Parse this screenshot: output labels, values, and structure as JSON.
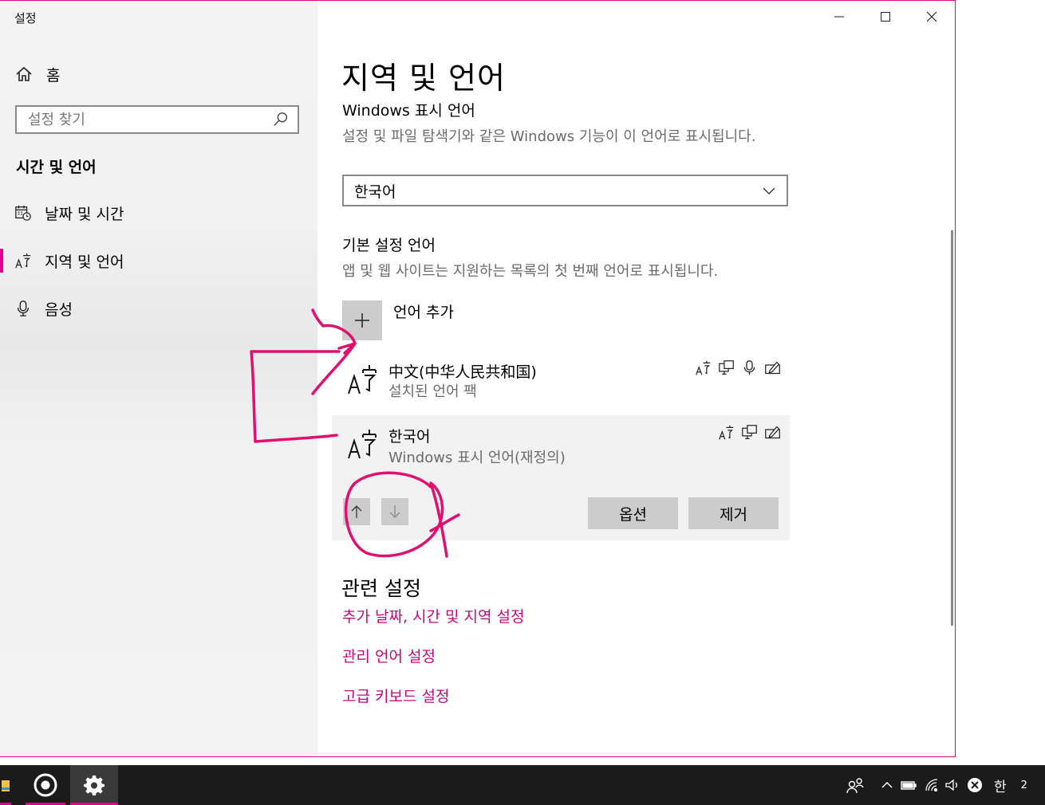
{
  "window": {
    "app_title": "설정",
    "controls": {
      "minimize": "minimize-icon",
      "maximize": "maximize-icon",
      "close": "close-icon"
    }
  },
  "sidebar": {
    "home_label": "홈",
    "search_placeholder": "설정 찾기",
    "section_title": "시간 및 언어",
    "items": [
      {
        "label": "날짜 및 시간",
        "icon": "calendar-clock-icon",
        "active": false
      },
      {
        "label": "지역 및 언어",
        "icon": "language-icon",
        "active": true
      },
      {
        "label": "음성",
        "icon": "microphone-icon",
        "active": false
      }
    ]
  },
  "main": {
    "page_title": "지역 및 언어",
    "display_language": {
      "label": "Windows 표시 언어",
      "description": "설정 및 파일 탐색기와 같은 Windows 기능이 이 언어로 표시됩니다.",
      "selected": "한국어"
    },
    "preferred_languages": {
      "label": "기본 설정 언어",
      "description": "앱 및 웹 사이트는 지원하는 목록의 첫 번째 언어로 표시됩니다.",
      "add_label": "언어 추가",
      "languages": [
        {
          "name": "中文(中华人民共和国)",
          "status": "설치된 언어 팩",
          "features": [
            "display-language-feature-icon",
            "text-to-speech-icon",
            "speech-recognition-icon",
            "handwriting-icon"
          ]
        },
        {
          "name": "한국어",
          "status": "Windows 표시 언어(재정의)",
          "features": [
            "display-language-feature-icon",
            "text-to-speech-icon",
            "handwriting-icon"
          ]
        }
      ],
      "options_label": "옵션",
      "remove_label": "제거"
    },
    "related": {
      "title": "관련 설정",
      "links": [
        "추가 날짜, 시간 및 지역 설정",
        "관리 언어 설정",
        "고급 키보드 설정"
      ]
    },
    "accent_color": "#e3008c",
    "link_color": "#c30a7e"
  },
  "taskbar": {
    "ime_indicator": "한",
    "clock": "2"
  }
}
